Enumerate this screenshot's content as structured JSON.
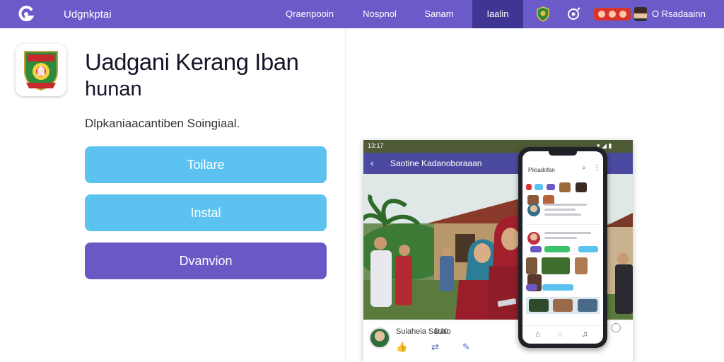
{
  "topbar": {
    "brand_title": "Udgnkptai",
    "nav": [
      "Qraenpooin",
      "Nospnol",
      "Sanam",
      "Iaalin"
    ],
    "active_nav": "Iaalin",
    "user_name": "O Rsadaainn"
  },
  "app": {
    "title": "Uadgani Kerang Iban",
    "subtitle": "hunan",
    "description": "Dlpkaniaacantiben Soingiaal.",
    "buttons": [
      "Toilare",
      "Instal",
      "Dvanvion"
    ]
  },
  "preview": {
    "header_title": "Saotine Kadanoboraaan",
    "status_time": "13:17",
    "footer_name": "Suiaheia Saoao",
    "footer_time": "DJ0",
    "phone_title": "Piioadofan"
  },
  "colors": {
    "topbar": "#6a5bc8",
    "nav_active": "#3f3593",
    "button_primary": "#5cc3f0",
    "button_secondary": "#6a59c5"
  }
}
